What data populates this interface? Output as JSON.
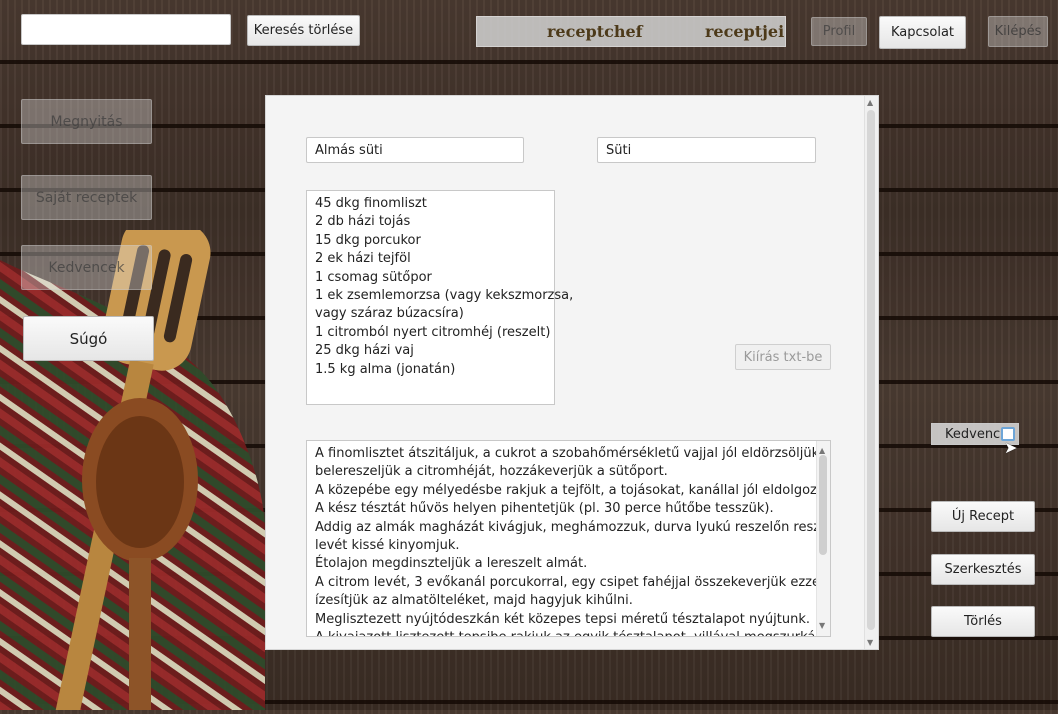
{
  "toolbar": {
    "search_value": "",
    "clear_search_label": "Keresés törlése",
    "title_left": "receptchef",
    "title_right": "receptjei",
    "profile_label": "Profil",
    "contact_label": "Kapcsolat",
    "exit_label": "Kilépés"
  },
  "sidebar": {
    "open_label": "Megnyitás",
    "own_recipes_label": "Saját receptek",
    "favorites_label": "Kedvencek",
    "help_label": "Súgó"
  },
  "recipe": {
    "name": "Almás süti",
    "category": "Süti",
    "export_label": "Kiírás txt-be",
    "ingredients": [
      "45 dkg finomliszt",
      "2 db házi tojás",
      "15 dkg porcukor",
      "2 ek házi tejföl",
      "1 csomag sütőpor",
      "1 ek zsemlemorzsa (vagy kekszmorzsa,",
      "vagy száraz búzacsíra)",
      "1 citromból nyert citromhéj (reszelt)",
      "25 dkg házi vaj",
      "1.5 kg alma (jonatán)"
    ],
    "instructions": [
      "A finomlisztet átszitáljuk, a cukrot a szobahőmérsékletű vajjal jól eldörzsöljük,",
      "belereszeljük a citromhéját, hozzákeverjük a sütőport.",
      "A közepébe egy mélyedésbe rakjuk a tejfölt, a tojásokat, kanállal jól eldolgozzuk.",
      "A kész tésztát hűvös helyen pihentetjük (pl. 30 perce hűtőbe tesszük).",
      "Addig az almák magházát kivágjuk, meghámozzuk, durva lyukú reszelőn reszeljük,",
      "levét kissé kinyomjuk.",
      "Étolajon megdinszteljük a lereszelt almát.",
      "A citrom levét, 3 evőkanál porcukorral, egy csipet fahéjjal összekeverjük ezzel",
      "ízesítjük az almatölteléket, majd hagyjuk kihűlni.",
      "Meglisztezett nyújtódeszkán két közepes tepsi méretű tésztalapot nyújtunk.",
      "A kivajazott lisztezett tepsibe rakjuk az egyik tésztalapot, villával megszurkáljuk"
    ]
  },
  "right": {
    "favorite_label": "Kedvenc",
    "new_recipe_label": "Új Recept",
    "edit_label": "Szerkesztés",
    "delete_label": "Törlés"
  }
}
